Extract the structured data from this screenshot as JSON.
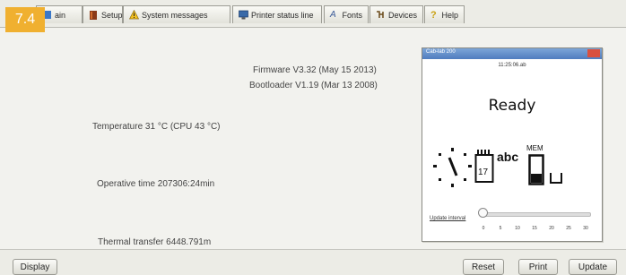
{
  "badge": "7.4",
  "tabs": [
    {
      "label": "ain",
      "icon": "status-icon"
    },
    {
      "label": "Setup",
      "icon": "book-icon"
    },
    {
      "label": "System messages",
      "icon": "warning-icon"
    },
    {
      "label": "Printer status line",
      "icon": "monitor-icon"
    },
    {
      "label": "Fonts",
      "icon": "font-icon"
    },
    {
      "label": "Devices",
      "icon": "devices-icon"
    },
    {
      "label": "Help",
      "icon": "help-icon"
    }
  ],
  "info": {
    "firmware": "Firmware V3.32 (May 15 2013)",
    "bootloader": "Bootloader V1.19 (Mar 13 2008)",
    "temperature": "Temperature 31 °C (CPU 43 °C)",
    "operative_time": "Operative time 207306:24min",
    "thermal_transfer": "Thermal transfer 6448.791m"
  },
  "preview": {
    "title": "Cab-lab 200",
    "time": "11:25:06.ab",
    "status": "Ready",
    "label_text": "abc",
    "mem_label": "MEM",
    "counter": "17",
    "update_label": "Update interval",
    "slider_value": 0,
    "scale": [
      "0",
      "5",
      "10",
      "15",
      "20",
      "25",
      "30"
    ]
  },
  "buttons": {
    "display": "Display",
    "reset": "Reset",
    "print": "Print",
    "update": "Update"
  },
  "colors": {
    "badge": "#f0b030",
    "titlebar": "#4f7cbf"
  }
}
